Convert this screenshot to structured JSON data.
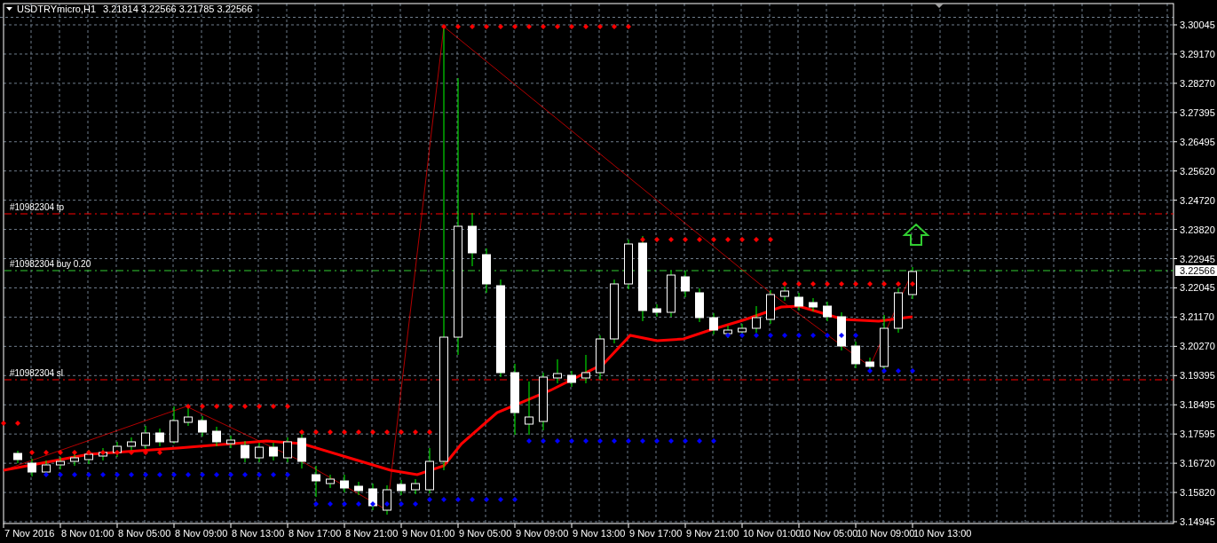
{
  "header": {
    "symbol": "USDTRYmicro,H1",
    "ohlc": "3.21814 3.22566 3.21785 3.22566"
  },
  "orders": [
    {
      "kind": "tp",
      "label": "#10982304 tp"
    },
    {
      "kind": "entry",
      "label": "#10982304 buy 0.20"
    },
    {
      "kind": "sl",
      "label": "#10982304 sl"
    }
  ],
  "current_price": "3.22566",
  "price_axis": [
    "3.30045",
    "3.29170",
    "3.28270",
    "3.27395",
    "3.26495",
    "3.25620",
    "3.24720",
    "3.23820",
    "3.22945",
    "3.22045",
    "3.21170",
    "3.20270",
    "3.19395",
    "3.18495",
    "3.17595",
    "3.16720",
    "3.15820",
    "3.14945"
  ],
  "time_axis": [
    "7 Nov 2016",
    "8 Nov 01:00",
    "8 Nov 05:00",
    "8 Nov 09:00",
    "8 Nov 13:00",
    "8 Nov 17:00",
    "8 Nov 21:00",
    "9 Nov 01:00",
    "9 Nov 05:00",
    "9 Nov 09:00",
    "9 Nov 13:00",
    "9 Nov 17:00",
    "9 Nov 21:00",
    "10 Nov 01:00",
    "10 Nov 05:00",
    "10 Nov 09:00",
    "10 Nov 13:00"
  ]
}
